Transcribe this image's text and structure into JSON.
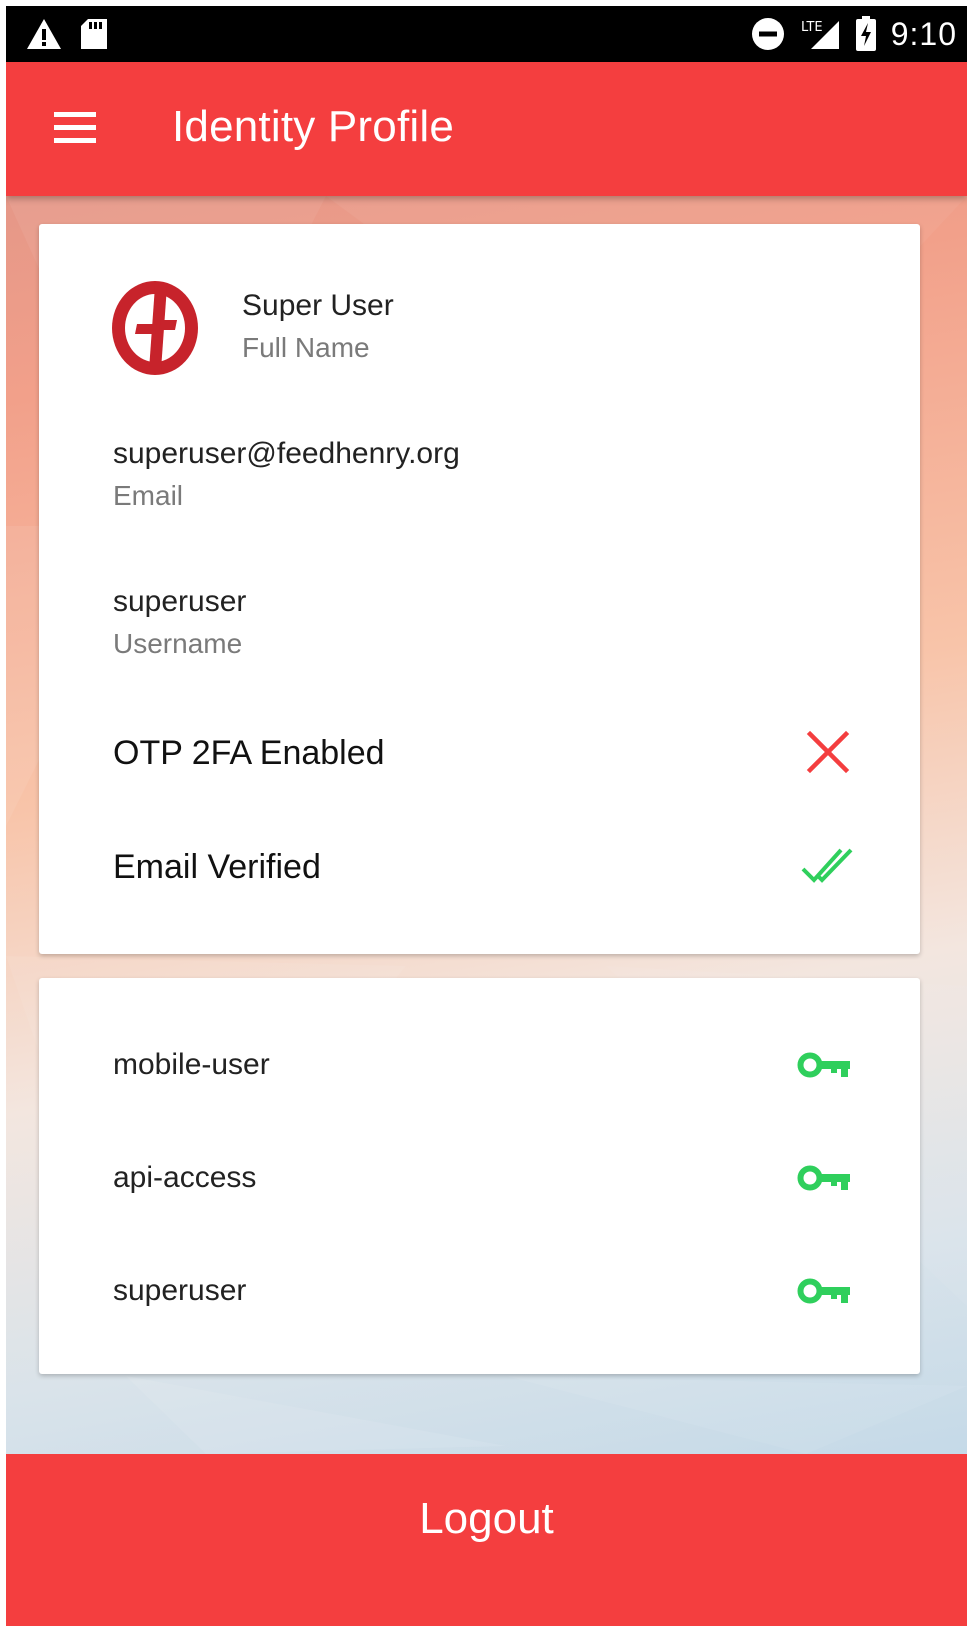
{
  "status_bar": {
    "time": "9:10",
    "network": "LTE",
    "icons": [
      "warning-icon",
      "sd-card-icon",
      "do-not-disturb-icon",
      "lte-signal-icon",
      "battery-charging-icon"
    ]
  },
  "app_bar": {
    "title": "Identity Profile",
    "menu_icon": "hamburger-menu-icon"
  },
  "profile": {
    "avatar_icon": "feedhenry-logo",
    "full_name": {
      "value": "Super User",
      "label": "Full Name"
    },
    "email": {
      "value": "superuser@feedhenry.org",
      "label": "Email"
    },
    "username": {
      "value": "superuser",
      "label": "Username"
    },
    "flags": [
      {
        "label": "OTP 2FA Enabled",
        "enabled": false,
        "icon": "close-icon"
      },
      {
        "label": "Email Verified",
        "enabled": true,
        "icon": "double-check-icon"
      }
    ]
  },
  "roles": [
    {
      "name": "mobile-user",
      "icon": "key-icon"
    },
    {
      "name": "api-access",
      "icon": "key-icon"
    },
    {
      "name": "superuser",
      "icon": "key-icon"
    }
  ],
  "logout": {
    "label": "Logout"
  },
  "colors": {
    "primary_red": "#f43e3f",
    "success_green": "#2fcf5c",
    "error_red": "#f43e3f",
    "logo_red": "#c7232b"
  }
}
